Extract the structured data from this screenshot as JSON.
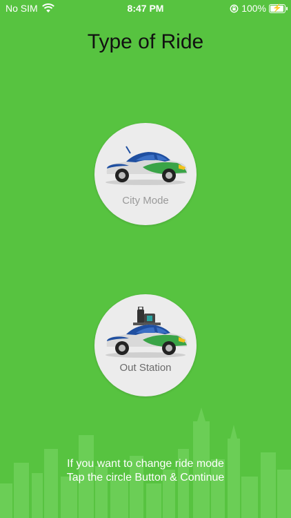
{
  "status_bar": {
    "carrier": "No SIM",
    "time": "8:47 PM",
    "battery_percent": "100%",
    "battery_level": 1.0
  },
  "page_title": "Type of Ride",
  "modes": [
    {
      "label": "City Mode",
      "icon": "sedan-car-icon"
    },
    {
      "label": "Out Station",
      "icon": "car-with-luggage-icon"
    }
  ],
  "footer": {
    "line1": "If you want to change ride mode",
    "line2": "Tap the circle Button & Continue"
  },
  "colors": {
    "background": "#57c340",
    "circle": "#ececec",
    "car_blue": "#1f4fa0",
    "car_green": "#3aa447",
    "car_yellow": "#f2c11b"
  }
}
